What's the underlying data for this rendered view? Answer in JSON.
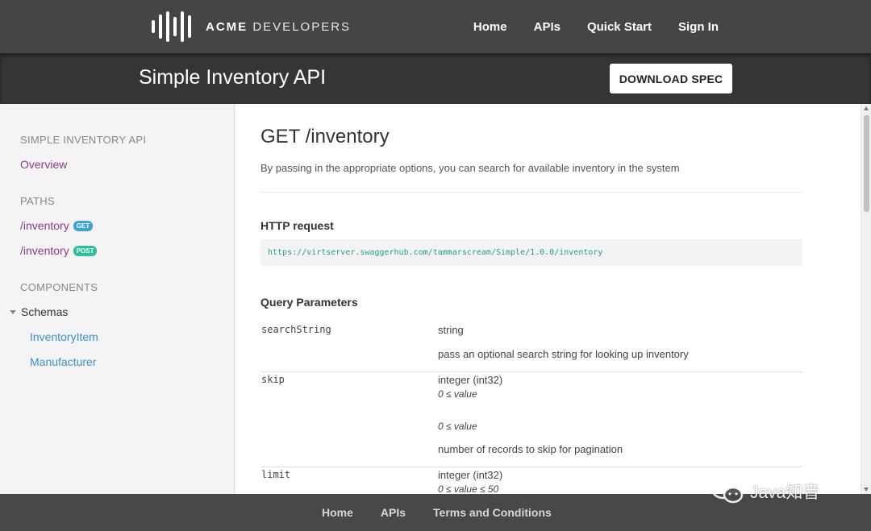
{
  "header": {
    "brand_bold": "ACME",
    "brand_light": "DEVELOPERS",
    "nav": [
      "Home",
      "APIs",
      "Quick Start",
      "Sign In"
    ]
  },
  "subheader": {
    "title": "Simple Inventory API",
    "download_label": "DOWNLOAD SPEC"
  },
  "sidebar": {
    "api_heading": "SIMPLE INVENTORY API",
    "overview": "Overview",
    "paths_heading": "PATHS",
    "paths": [
      {
        "label": "/inventory",
        "method": "GET"
      },
      {
        "label": "/inventory",
        "method": "POST"
      }
    ],
    "components_heading": "COMPONENTS",
    "schemas_label": "Schemas",
    "schemas": [
      "InventoryItem",
      "Manufacturer"
    ]
  },
  "main": {
    "title": "GET /inventory",
    "description": "By passing in the appropriate options, you can search for available inventory in the system",
    "http_request_heading": "HTTP request",
    "request_url": "https://virtserver.swaggerhub.com/tammarscream/Simple/1.0.0/inventory",
    "query_heading": "Query Parameters",
    "params": [
      {
        "name": "searchString",
        "type": "string",
        "constraint1": "",
        "constraint2": "",
        "description": "pass an optional search string for looking up inventory"
      },
      {
        "name": "skip",
        "type": "integer (int32)",
        "constraint1": "0 ≤ value",
        "constraint2": "0 ≤ value",
        "description": "number of records to skip for pagination"
      },
      {
        "name": "limit",
        "type": "integer (int32)",
        "constraint1": "0 ≤ value ≤ 50",
        "constraint2": "",
        "description": ""
      }
    ]
  },
  "footer": {
    "nav": [
      "Home",
      "APIs",
      "Terms and Conditions"
    ]
  },
  "watermark": {
    "text": "Java知音"
  },
  "colors": {
    "topbar": "#444546",
    "subbar": "#353535",
    "link_purple": "#8b3b8c",
    "link_blue": "#3d8fc6",
    "get_badge": "#3fa3d8",
    "post_badge": "#2bbf9c",
    "code_url": "#2a9a8a"
  }
}
